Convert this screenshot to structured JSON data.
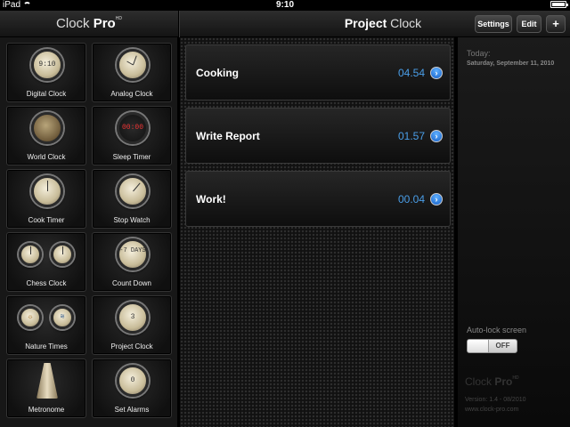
{
  "status_bar": {
    "device": "iPad",
    "time": "9:10"
  },
  "app": {
    "name_light": "Clock",
    "name_bold": "Pro",
    "superscript": "HD"
  },
  "header": {
    "title_bold": "Project",
    "title_rest": "Clock",
    "settings_label": "Settings",
    "edit_label": "Edit",
    "add_label": "+"
  },
  "sidebar": {
    "items": [
      {
        "label": "Digital Clock",
        "face_text": "9:10",
        "icon": "digital-clock-icon"
      },
      {
        "label": "Analog Clock",
        "face_text": "",
        "icon": "analog-clock-icon"
      },
      {
        "label": "World Clock",
        "face_text": "",
        "icon": "globe-icon"
      },
      {
        "label": "Sleep Timer",
        "face_text": "00:00",
        "icon": "sleep-timer-icon"
      },
      {
        "label": "Cook Timer",
        "face_text": "",
        "icon": "cook-timer-icon"
      },
      {
        "label": "Stop Watch",
        "face_text": "",
        "icon": "stopwatch-icon"
      },
      {
        "label": "Chess Clock",
        "face_text": "",
        "icon": "chess-clock-icon"
      },
      {
        "label": "Count Down",
        "face_text": "-7 DAYS",
        "icon": "countdown-icon"
      },
      {
        "label": "Nature Times",
        "face_text": "",
        "icon": "nature-times-icon"
      },
      {
        "label": "Project Clock",
        "face_text": "3",
        "icon": "project-clock-icon"
      },
      {
        "label": "Metronome",
        "face_text": "",
        "icon": "metronome-icon"
      },
      {
        "label": "Set Alarms",
        "face_text": "0",
        "icon": "alarm-icon"
      }
    ]
  },
  "projects": [
    {
      "name": "Cooking",
      "time": "04.54"
    },
    {
      "name": "Write Report",
      "time": "01.57"
    },
    {
      "name": "Work!",
      "time": "00.04"
    }
  ],
  "info": {
    "today_label": "Today:",
    "today_date": "Saturday, September 11, 2010",
    "autolock_label": "Auto-lock screen",
    "autolock_state": "OFF",
    "brand_light": "Clock",
    "brand_bold": "Pro",
    "brand_sup": "HD",
    "version": "Version: 1.4 - 08/2010",
    "website": "www.clock-pro.com"
  }
}
